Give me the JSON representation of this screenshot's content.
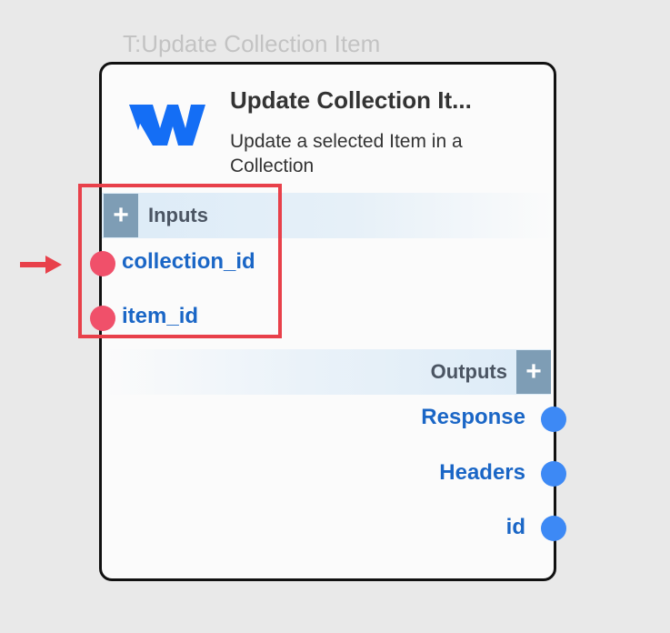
{
  "node": {
    "caption": "T:Update Collection Item",
    "title": "Update Collection It...",
    "description": "Update a selected Item in a Collection",
    "logo_icon": "webflow-logo-icon",
    "brand_color": "#146ef5"
  },
  "inputs": {
    "label": "Inputs",
    "add_label": "+",
    "ports": [
      {
        "name": "collection_id"
      },
      {
        "name": "item_id"
      }
    ]
  },
  "outputs": {
    "label": "Outputs",
    "add_label": "+",
    "ports": [
      {
        "name": "Response"
      },
      {
        "name": "Headers"
      },
      {
        "name": "id"
      }
    ]
  },
  "colors": {
    "input_port": "#f0506a",
    "output_port": "#3d89f5",
    "port_label": "#1a66c6",
    "highlight": "#e8404a"
  }
}
